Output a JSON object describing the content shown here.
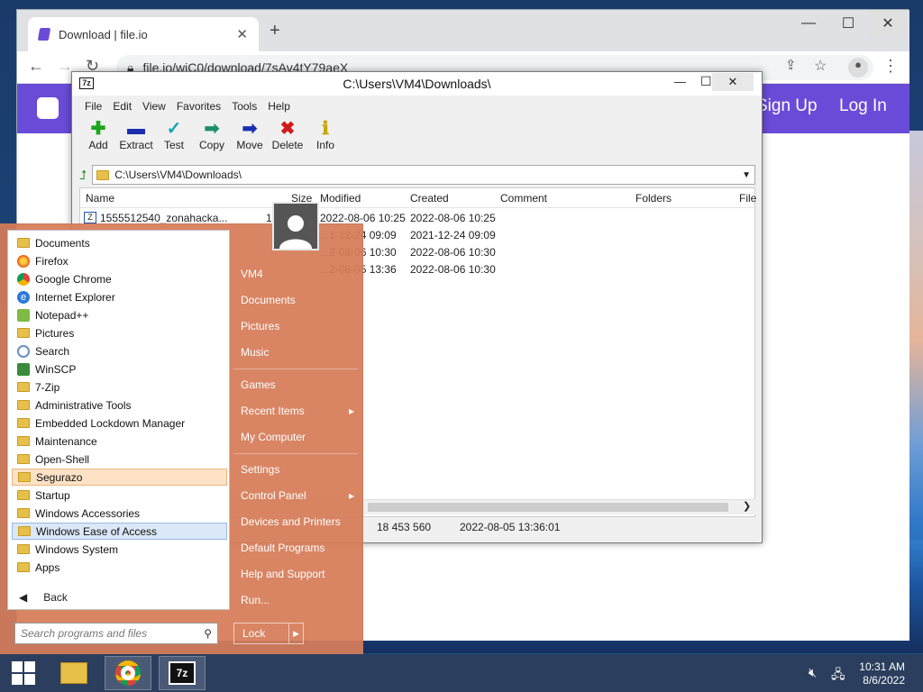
{
  "browser": {
    "tab_title": "Download | file.io",
    "url": "file.io/wiC0/download/7sAv4tY79aeX",
    "site_signup": "Sign Up",
    "site_login": "Log In"
  },
  "sevenzip": {
    "title": "C:\\Users\\VM4\\Downloads\\",
    "menu": [
      "File",
      "Edit",
      "View",
      "Favorites",
      "Tools",
      "Help"
    ],
    "toolbar": [
      {
        "label": "Add",
        "icon": "plus-icon"
      },
      {
        "label": "Extract",
        "icon": "minus-icon"
      },
      {
        "label": "Test",
        "icon": "check-icon"
      },
      {
        "label": "Copy",
        "icon": "copy-arrow-icon"
      },
      {
        "label": "Move",
        "icon": "move-arrow-icon"
      },
      {
        "label": "Delete",
        "icon": "delete-x-icon"
      },
      {
        "label": "Info",
        "icon": "info-icon"
      }
    ],
    "path": "C:\\Users\\VM4\\Downloads\\",
    "columns": [
      "Name",
      "Size",
      "Modified",
      "Created",
      "Comment",
      "Folders",
      "File"
    ],
    "rows": [
      {
        "name": "1555512540_zonahacka...",
        "size": "1",
        "modified": "2022-08-06 10:25",
        "created": "2022-08-06 10:25"
      },
      {
        "name": "",
        "size": "",
        "modified": "...1-12-24 09:09",
        "created": "2021-12-24 09:09"
      },
      {
        "name": "",
        "size": "",
        "modified": "...2-08-06 10:30",
        "created": "2022-08-06 10:30"
      },
      {
        "name": "",
        "size": "",
        "modified": "...2-08-05 13:36",
        "created": "2022-08-06 10:30"
      }
    ],
    "status_size": "18 453 560",
    "status_date": "2022-08-05 13:36:01"
  },
  "startmenu": {
    "programs": [
      {
        "label": "Documents",
        "icon": "folder"
      },
      {
        "label": "Firefox",
        "icon": "firefox"
      },
      {
        "label": "Google Chrome",
        "icon": "chrome"
      },
      {
        "label": "Internet Explorer",
        "icon": "ie"
      },
      {
        "label": "Notepad++",
        "icon": "notepad"
      },
      {
        "label": "Pictures",
        "icon": "folder"
      },
      {
        "label": "Search",
        "icon": "search"
      },
      {
        "label": "WinSCP",
        "icon": "winscp"
      },
      {
        "label": "7-Zip",
        "icon": "folder"
      },
      {
        "label": "Administrative Tools",
        "icon": "folder"
      },
      {
        "label": "Embedded Lockdown Manager",
        "icon": "folder"
      },
      {
        "label": "Maintenance",
        "icon": "folder"
      },
      {
        "label": "Open-Shell",
        "icon": "folder"
      },
      {
        "label": "Segurazo",
        "icon": "folder"
      },
      {
        "label": "Startup",
        "icon": "folder"
      },
      {
        "label": "Windows Accessories",
        "icon": "folder"
      },
      {
        "label": "Windows Ease of Access",
        "icon": "folder"
      },
      {
        "label": "Windows System",
        "icon": "folder"
      },
      {
        "label": "Apps",
        "icon": "folder"
      }
    ],
    "back": "Back",
    "search_placeholder": "Search programs and files",
    "right_items": [
      "VM4",
      "Documents",
      "Pictures",
      "Music",
      "Games",
      "Recent Items",
      "My Computer",
      "Settings",
      "Control Panel",
      "Devices and Printers",
      "Default Programs",
      "Help and Support",
      "Run..."
    ],
    "lock": "Lock"
  },
  "taskbar": {
    "time": "10:31 AM",
    "date": "8/6/2022"
  }
}
